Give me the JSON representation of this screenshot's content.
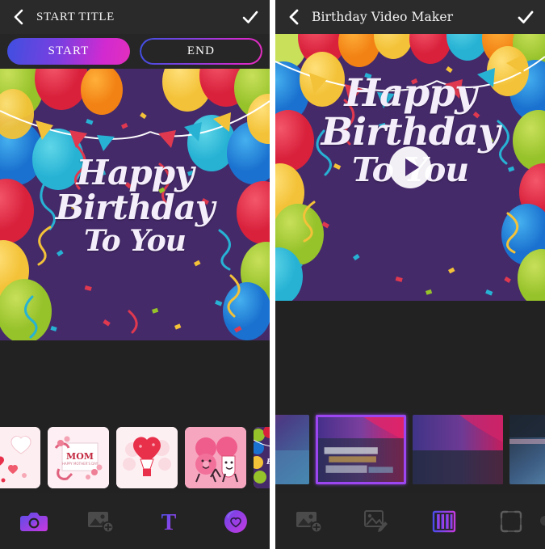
{
  "app": {
    "background_color": "#222222",
    "accent_gradient_start": "#3f4fe0",
    "accent_gradient_end": "#e22fbd",
    "card_bg_color": "#452a6a",
    "selection_color": "#9b46f0"
  },
  "left_screen": {
    "header": {
      "back_icon": "chevron-left-icon",
      "title": "START TITLE",
      "confirm_icon": "check-icon"
    },
    "segments": [
      {
        "label": "START",
        "state": "active",
        "style": "filled-gradient"
      },
      {
        "label": "END",
        "state": "inactive",
        "style": "outlined-gradient"
      }
    ],
    "canvas": {
      "card_line1": "Happy",
      "card_line2": "Birthday",
      "card_line3": "To You",
      "theme": "balloons-confetti-purple"
    },
    "templates": [
      {
        "name": "hearts-card",
        "label": "Hearts"
      },
      {
        "name": "mom-card",
        "label": "MOM"
      },
      {
        "name": "heart-balloon-card",
        "label": "Heart Balloon"
      },
      {
        "name": "donut-cup-card",
        "label": "Donut & Cup"
      },
      {
        "name": "birthday-balloons-card",
        "label": "Happy Birthday To You"
      }
    ],
    "tabs": [
      {
        "name": "camera-icon",
        "label": "Camera",
        "state": "active"
      },
      {
        "name": "image-add-icon",
        "label": "Add Image",
        "state": "inactive"
      },
      {
        "name": "text-icon",
        "label": "T",
        "state": "active"
      },
      {
        "name": "sticker-icon",
        "label": "Sticker",
        "state": "active"
      }
    ]
  },
  "right_screen": {
    "header": {
      "back_icon": "chevron-left-icon",
      "title": "Birthday Video Maker",
      "confirm_icon": "check-icon"
    },
    "canvas": {
      "card_line1": "Happy",
      "card_line2": "Birthday",
      "card_line3": "To You",
      "theme": "balloons-confetti-purple",
      "play_button": "play-icon"
    },
    "video_frames": [
      {
        "name": "video-frame",
        "selected": false
      },
      {
        "name": "video-frame",
        "selected": true
      },
      {
        "name": "video-frame",
        "selected": false
      },
      {
        "name": "video-frame",
        "selected": false
      }
    ],
    "tabs": [
      {
        "name": "image-add-icon",
        "label": "Add Image",
        "state": "inactive"
      },
      {
        "name": "image-edit-icon",
        "label": "Edit Image",
        "state": "inactive"
      },
      {
        "name": "filmstrip-icon",
        "label": "Frames",
        "state": "active"
      },
      {
        "name": "crop-frame-icon",
        "label": "Crop",
        "state": "inactive"
      },
      {
        "name": "more-icon",
        "label": "More",
        "state": "inactive"
      }
    ]
  }
}
